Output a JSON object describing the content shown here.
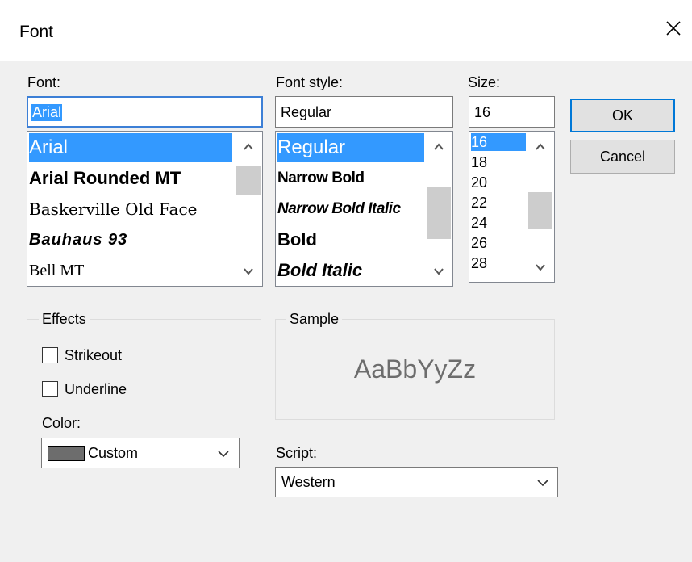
{
  "dialog": {
    "title": "Font"
  },
  "font": {
    "label": "Font:",
    "value": "Arial",
    "items": [
      "Arial",
      "Arial Rounded MT",
      "Baskerville Old Face",
      "Bauhaus 93",
      "Bell MT"
    ]
  },
  "style": {
    "label": "Font style:",
    "value": "Regular",
    "items": [
      "Regular",
      "Narrow Bold",
      "Narrow Bold Italic",
      "Bold",
      "Bold Italic"
    ]
  },
  "size": {
    "label": "Size:",
    "value": "16",
    "items": [
      "16",
      "18",
      "20",
      "22",
      "24",
      "26",
      "28"
    ]
  },
  "buttons": {
    "ok": "OK",
    "cancel": "Cancel"
  },
  "effects": {
    "label": "Effects",
    "strikeout": "Strikeout",
    "underline": "Underline",
    "strikeout_checked": false,
    "underline_checked": false,
    "color_label": "Color:",
    "color_value": "Custom",
    "color_swatch": "#6d6d6d"
  },
  "sample": {
    "label": "Sample",
    "text": "AaBbYyZz",
    "text_color": "#6d6d6d"
  },
  "script": {
    "label": "Script:",
    "value": "Western"
  },
  "colors": {
    "selection": "#3399ff",
    "focus_border": "#3c7fd6",
    "default_button_border": "#0078d7"
  }
}
